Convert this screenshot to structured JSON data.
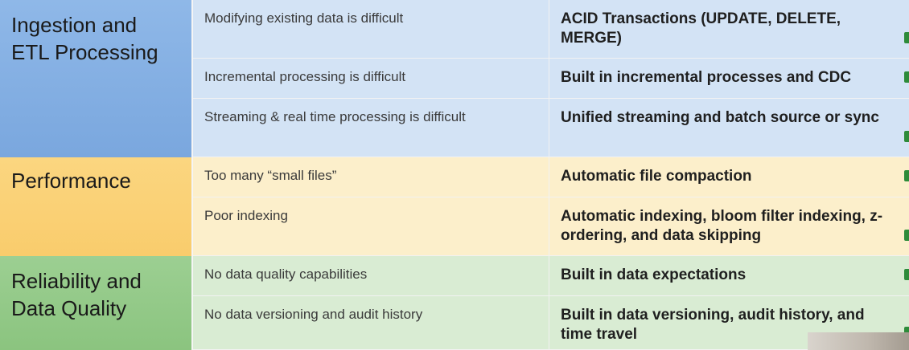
{
  "table": {
    "groups": [
      {
        "category": "Ingestion and ETL Processing",
        "color": "#8fb8e8",
        "rows": [
          {
            "problem": "Modifying existing data is difficult",
            "solution": "ACID Transactions (UPDATE, DELETE, MERGE)"
          },
          {
            "problem": "Incremental processing is difficult",
            "solution": "Built in incremental processes and CDC"
          },
          {
            "problem": "Streaming & real time processing is difficult",
            "solution": "Unified streaming and batch source or sync"
          }
        ]
      },
      {
        "category": "Performance",
        "color": "#fbd680",
        "rows": [
          {
            "problem": "Too many “small files”",
            "solution": "Automatic file compaction"
          },
          {
            "problem": "Poor indexing",
            "solution": "Automatic indexing, bloom filter indexing, z-ordering, and data skipping"
          }
        ]
      },
      {
        "category": "Reliability and Data Quality",
        "color": "#9ccf92",
        "rows": [
          {
            "problem": "No data quality capabilities",
            "solution": "Built in data expectations"
          },
          {
            "problem": "No data versioning and audit history",
            "solution": "Built in data versioning, audit history, and time travel"
          }
        ]
      }
    ]
  }
}
